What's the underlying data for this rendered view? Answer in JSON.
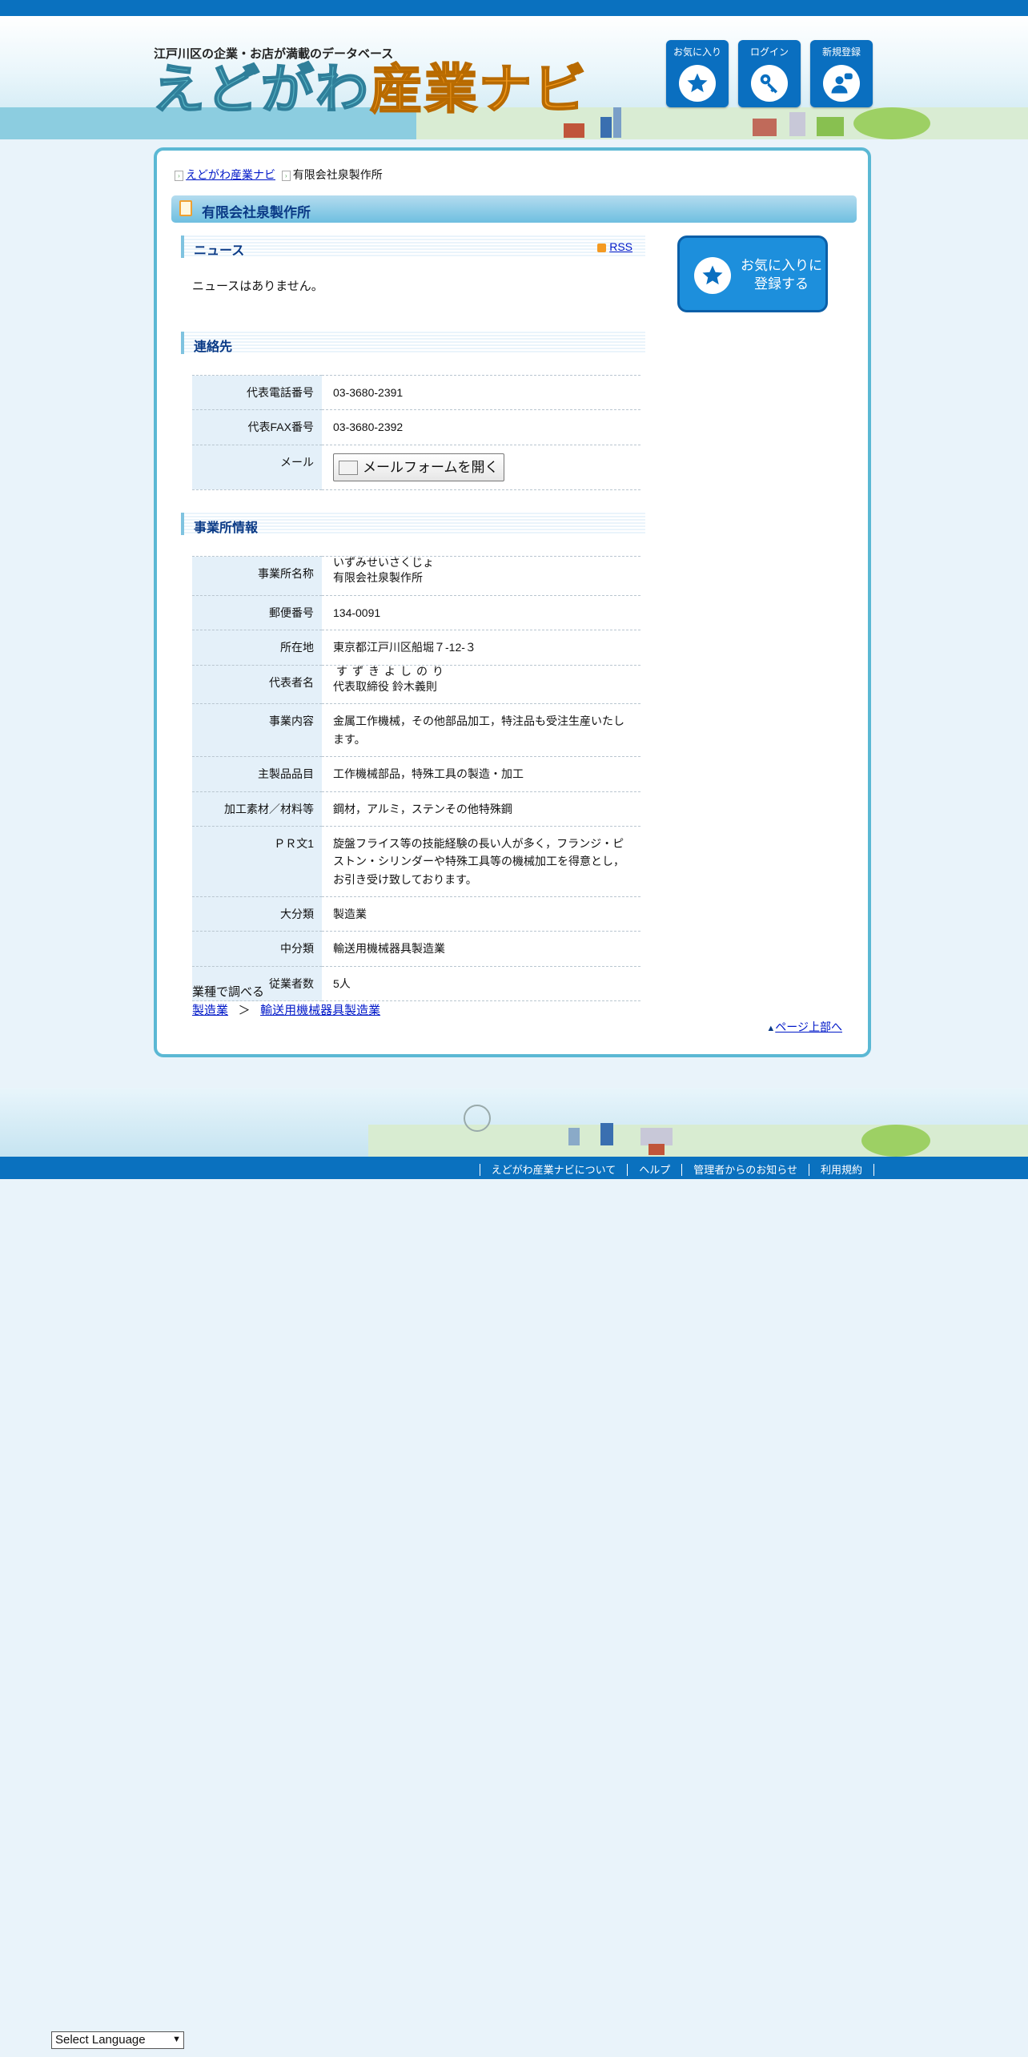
{
  "header": {
    "tagline": "江戸川区の企業・お店が満載のデータベース",
    "logo_part1": "えどがわ",
    "logo_part2": "産業ナビ",
    "buttons": [
      {
        "label": "お気に入り",
        "icon": "star-icon"
      },
      {
        "label": "ログイン",
        "icon": "key-icon"
      },
      {
        "label": "新規登録",
        "icon": "user-add-icon"
      }
    ]
  },
  "breadcrumb": {
    "home": "えどがわ産業ナビ",
    "current": "有限会社泉製作所"
  },
  "page_title": "有限会社泉製作所",
  "news": {
    "heading": "ニュース",
    "rss_label": "RSS",
    "empty_text": "ニュースはありません。"
  },
  "contact": {
    "heading": "連絡先",
    "rows": {
      "tel_label": "代表電話番号",
      "tel_value": "03-3680-2391",
      "fax_label": "代表FAX番号",
      "fax_value": "03-3680-2392",
      "mail_label": "メール",
      "mail_button": "メールフォームを開く"
    }
  },
  "business": {
    "heading": "事業所情報",
    "name_label": "事業所名称",
    "name_kana": "いずみせいさくじょ",
    "name_value": "有限会社泉製作所",
    "zip_label": "郵便番号",
    "zip_value": "134-0091",
    "address_label": "所在地",
    "address_value": "東京都江戸川区船堀７-12-３",
    "rep_label": "代表者名",
    "rep_kana": "すずきよしのり",
    "rep_value": "代表取締役 鈴木義則",
    "content_label": "事業内容",
    "content_value": "金属工作機械，その他部品加工，特注品も受注生産いたします。",
    "products_label": "主製品品目",
    "products_value": "工作機械部品，特殊工具の製造・加工",
    "materials_label": "加工素材／材料等",
    "materials_value": "鋼材，アルミ，ステンその他特殊鋼",
    "pr_label": "ＰＲ文1",
    "pr_value": "旋盤フライス等の技能経験の長い人が多く，フランジ・ピストン・シリンダーや特殊工具等の機械加工を得意とし，お引き受け致しております。",
    "major_label": "大分類",
    "major_value": "製造業",
    "middle_label": "中分類",
    "middle_value": "輸送用機械器具製造業",
    "staff_label": "従業者数",
    "staff_value": "5人"
  },
  "favorite_button": {
    "line1": "お気に入りに",
    "line2": "登録する"
  },
  "industry": {
    "heading": "業種で調べる",
    "link1": "製造業",
    "separator": "＞",
    "link2": "輸送用機械器具製造業"
  },
  "to_top": "ページ上部へ",
  "footer": {
    "links": [
      "えどがわ産業ナビについて",
      "ヘルプ",
      "管理者からのお知らせ",
      "利用規約"
    ]
  },
  "language_select": "Select Language",
  "colors": {
    "brand_blue": "#0a71bf",
    "panel_border": "#5bb8d4",
    "heading_text": "#0a3a86",
    "logo_orange": "#f39a1e"
  }
}
